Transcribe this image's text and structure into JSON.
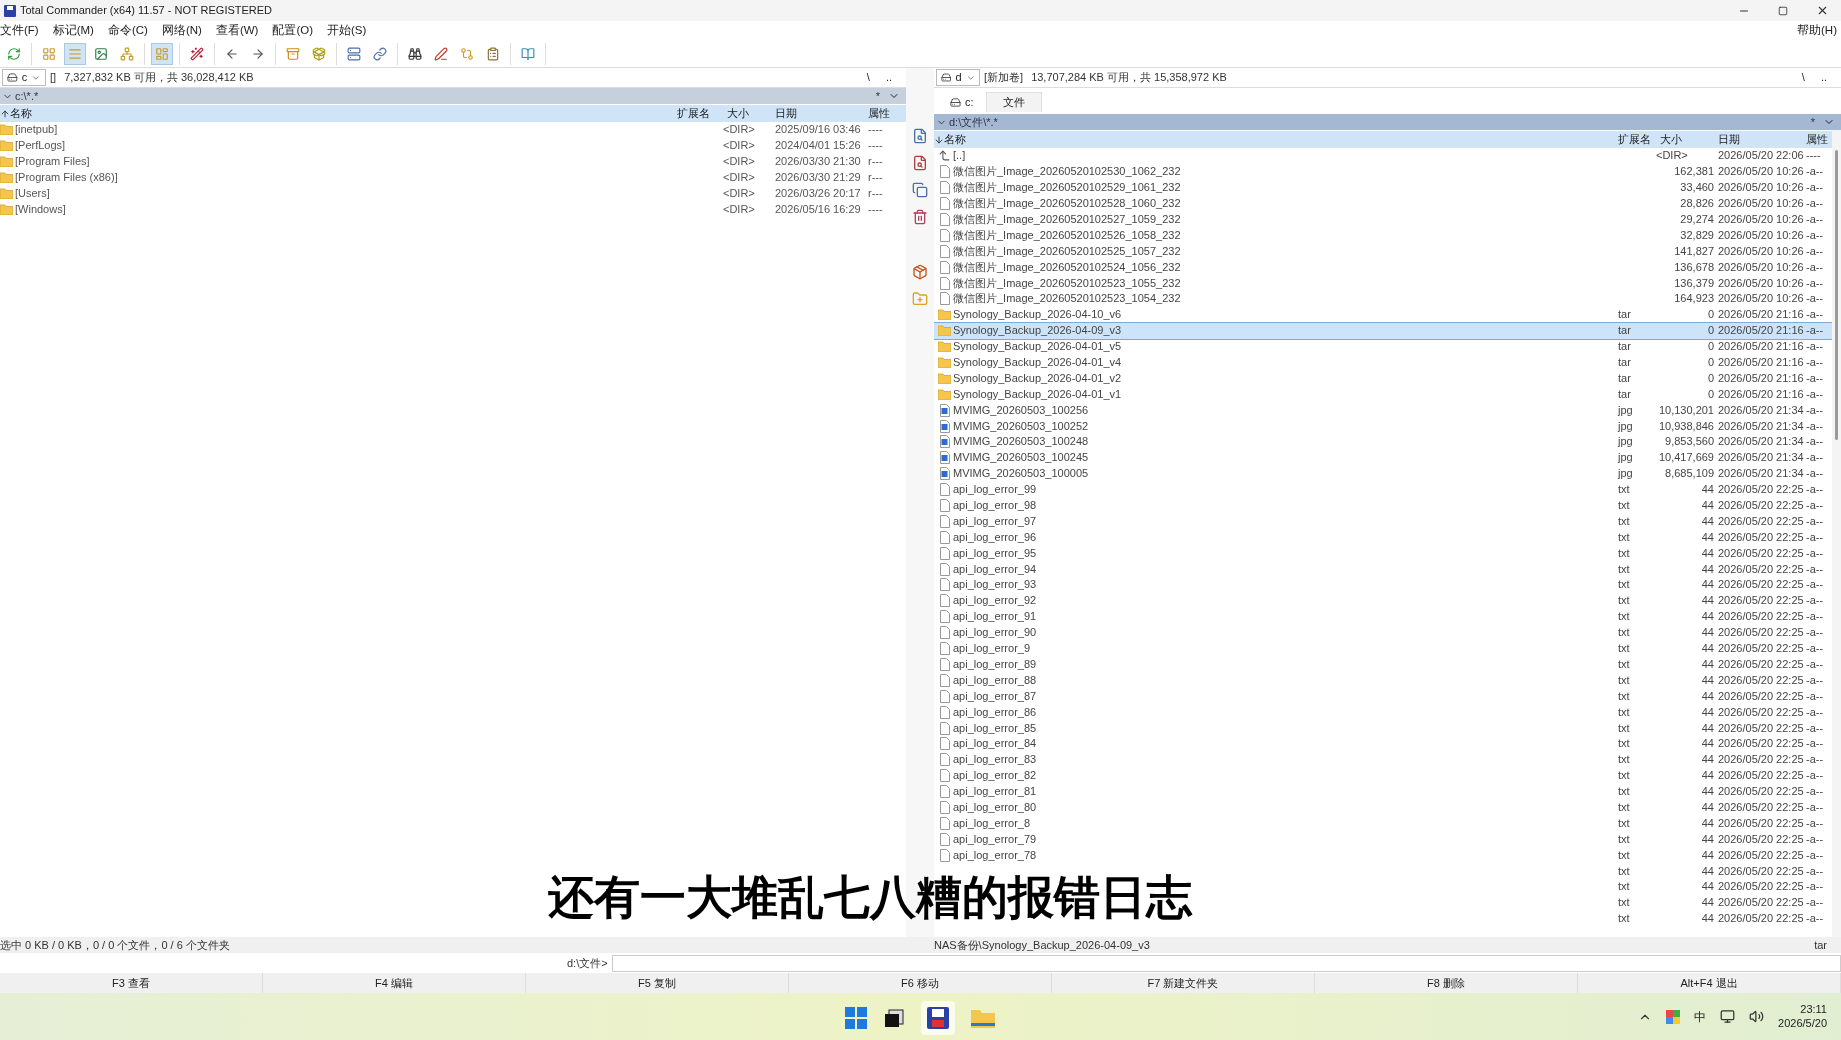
{
  "window": {
    "title": "Total Commander (x64) 11.57 - NOT REGISTERED",
    "help": "帮助(H)"
  },
  "menu": [
    "文件(F)",
    "标记(M)",
    "命令(C)",
    "网络(N)",
    "查看(W)",
    "配置(O)",
    "开始(S)"
  ],
  "toolbar": [
    [
      {
        "pressed": false
      }
    ],
    [
      {
        "pressed": false
      },
      {
        "pressed": true
      },
      {
        "pressed": false
      },
      {
        "pressed": false
      }
    ],
    [
      {
        "pressed": true
      }
    ],
    [
      {
        "pressed": false
      }
    ],
    [
      {
        "pressed": false
      },
      {
        "pressed": false
      }
    ],
    [
      {
        "pressed": false
      },
      {
        "pressed": false
      }
    ],
    [
      {
        "pressed": false
      },
      {
        "pressed": false
      }
    ],
    [
      {
        "pressed": false
      },
      {
        "pressed": false
      },
      {
        "pressed": false
      },
      {
        "pressed": false
      }
    ],
    [
      {
        "pressed": false
      }
    ]
  ],
  "left_panel": {
    "drive": "c",
    "volume": "[]",
    "free_space": "7,327,832 KB 可用，共 36,028,412 KB",
    "nav": [
      "\\",
      ".."
    ],
    "path": "c:\\*.*",
    "star": "*",
    "columns": [
      "名称",
      "扩展名",
      "大小",
      "日期",
      "属性"
    ],
    "rows": [
      {
        "kind": "folder",
        "name": "[inetpub]",
        "size": "<DIR>",
        "date": "2025/09/16 03:46",
        "attr": "----",
        "selected": false
      },
      {
        "kind": "folder",
        "name": "[PerfLogs]",
        "size": "<DIR>",
        "date": "2024/04/01 15:26",
        "attr": "----",
        "selected": false
      },
      {
        "kind": "folder",
        "name": "[Program Files]",
        "size": "<DIR>",
        "date": "2026/03/30 21:30",
        "attr": "r---",
        "selected": false
      },
      {
        "kind": "folder",
        "name": "[Program Files (x86)]",
        "size": "<DIR>",
        "date": "2026/03/30 21:29",
        "attr": "r---",
        "selected": false
      },
      {
        "kind": "folder",
        "name": "[Users]",
        "size": "<DIR>",
        "date": "2026/03/26 20:17",
        "attr": "r---",
        "selected": false
      },
      {
        "kind": "folder",
        "name": "[Windows]",
        "size": "<DIR>",
        "date": "2026/05/16 16:29",
        "attr": "----",
        "selected": false
      }
    ],
    "status": "选中 0 KB / 0 KB，0 / 0 个文件，0 / 6 个文件夹"
  },
  "right_panel": {
    "drive": "d",
    "volume": "[新加卷]",
    "free_space": "13,707,284 KB 可用，共 15,358,972 KB",
    "nav": [
      "\\",
      ".."
    ],
    "tabs": [
      {
        "label": "c:",
        "selected": false
      },
      {
        "label": "文件",
        "selected": true
      }
    ],
    "path": "d:\\文件\\*.*",
    "star": "*",
    "columns": [
      "名称",
      "扩展名",
      "大小",
      "日期",
      "属性"
    ],
    "rows": [
      {
        "kind": "up",
        "name": "[..]",
        "size": "<DIR>",
        "date": "2026/05/20 22:06",
        "attr": "----",
        "selected": false
      },
      {
        "kind": "file",
        "name": "微信图片_Image_20260520102530_1062_232",
        "size": "162,381",
        "date": "2026/05/20 10:26",
        "attr": "-a--",
        "selected": false
      },
      {
        "kind": "file",
        "name": "微信图片_Image_20260520102529_1061_232",
        "size": "33,460",
        "date": "2026/05/20 10:26",
        "attr": "-a--",
        "selected": false
      },
      {
        "kind": "file",
        "name": "微信图片_Image_20260520102528_1060_232",
        "size": "28,826",
        "date": "2026/05/20 10:26",
        "attr": "-a--",
        "selected": false
      },
      {
        "kind": "file",
        "name": "微信图片_Image_20260520102527_1059_232",
        "size": "29,274",
        "date": "2026/05/20 10:26",
        "attr": "-a--",
        "selected": false
      },
      {
        "kind": "file",
        "name": "微信图片_Image_20260520102526_1058_232",
        "size": "32,829",
        "date": "2026/05/20 10:26",
        "attr": "-a--",
        "selected": false
      },
      {
        "kind": "file",
        "name": "微信图片_Image_20260520102525_1057_232",
        "size": "141,827",
        "date": "2026/05/20 10:26",
        "attr": "-a--",
        "selected": false
      },
      {
        "kind": "file",
        "name": "微信图片_Image_20260520102524_1056_232",
        "size": "136,678",
        "date": "2026/05/20 10:26",
        "attr": "-a--",
        "selected": false
      },
      {
        "kind": "file",
        "name": "微信图片_Image_20260520102523_1055_232",
        "size": "136,379",
        "date": "2026/05/20 10:26",
        "attr": "-a--",
        "selected": false
      },
      {
        "kind": "file",
        "name": "微信图片_Image_20260520102523_1054_232",
        "size": "164,923",
        "date": "2026/05/20 10:26",
        "attr": "-a--",
        "selected": false
      },
      {
        "kind": "folder",
        "name": "Synology_Backup_2026-04-10_v6",
        "ext": "tar",
        "size": "0",
        "date": "2026/05/20 21:16",
        "attr": "-a--",
        "selected": false
      },
      {
        "kind": "folder",
        "name": "Synology_Backup_2026-04-09_v3",
        "ext": "tar",
        "size": "0",
        "date": "2026/05/20 21:16",
        "attr": "-a--",
        "selected": true
      },
      {
        "kind": "folder",
        "name": "Synology_Backup_2026-04-01_v5",
        "ext": "tar",
        "size": "0",
        "date": "2026/05/20 21:16",
        "attr": "-a--",
        "selected": false
      },
      {
        "kind": "folder",
        "name": "Synology_Backup_2026-04-01_v4",
        "ext": "tar",
        "size": "0",
        "date": "2026/05/20 21:16",
        "attr": "-a--",
        "selected": false
      },
      {
        "kind": "folder",
        "name": "Synology_Backup_2026-04-01_v2",
        "ext": "tar",
        "size": "0",
        "date": "2026/05/20 21:16",
        "attr": "-a--",
        "selected": false
      },
      {
        "kind": "folder",
        "name": "Synology_Backup_2026-04-01_v1",
        "ext": "tar",
        "size": "0",
        "date": "2026/05/20 21:16",
        "attr": "-a--",
        "selected": false
      },
      {
        "kind": "image",
        "name": "MVIMG_20260503_100256",
        "ext": "jpg",
        "size": "10,130,201",
        "date": "2026/05/20 21:34",
        "attr": "-a--",
        "selected": false
      },
      {
        "kind": "image",
        "name": "MVIMG_20260503_100252",
        "ext": "jpg",
        "size": "10,938,846",
        "date": "2026/05/20 21:34",
        "attr": "-a--",
        "selected": false
      },
      {
        "kind": "image",
        "name": "MVIMG_20260503_100248",
        "ext": "jpg",
        "size": "9,853,560",
        "date": "2026/05/20 21:34",
        "attr": "-a--",
        "selected": false
      },
      {
        "kind": "image",
        "name": "MVIMG_20260503_100245",
        "ext": "jpg",
        "size": "10,417,669",
        "date": "2026/05/20 21:34",
        "attr": "-a--",
        "selected": false
      },
      {
        "kind": "image",
        "name": "MVIMG_20260503_100005",
        "ext": "jpg",
        "size": "8,685,109",
        "date": "2026/05/20 21:34",
        "attr": "-a--",
        "selected": false
      },
      {
        "kind": "file",
        "name": "api_log_error_99",
        "ext": "txt",
        "size": "44",
        "date": "2026/05/20 22:25",
        "attr": "-a--",
        "selected": false
      },
      {
        "kind": "file",
        "name": "api_log_error_98",
        "ext": "txt",
        "size": "44",
        "date": "2026/05/20 22:25",
        "attr": "-a--",
        "selected": false
      },
      {
        "kind": "file",
        "name": "api_log_error_97",
        "ext": "txt",
        "size": "44",
        "date": "2026/05/20 22:25",
        "attr": "-a--",
        "selected": false
      },
      {
        "kind": "file",
        "name": "api_log_error_96",
        "ext": "txt",
        "size": "44",
        "date": "2026/05/20 22:25",
        "attr": "-a--",
        "selected": false
      },
      {
        "kind": "file",
        "name": "api_log_error_95",
        "ext": "txt",
        "size": "44",
        "date": "2026/05/20 22:25",
        "attr": "-a--",
        "selected": false
      },
      {
        "kind": "file",
        "name": "api_log_error_94",
        "ext": "txt",
        "size": "44",
        "date": "2026/05/20 22:25",
        "attr": "-a--",
        "selected": false
      },
      {
        "kind": "file",
        "name": "api_log_error_93",
        "ext": "txt",
        "size": "44",
        "date": "2026/05/20 22:25",
        "attr": "-a--",
        "selected": false
      },
      {
        "kind": "file",
        "name": "api_log_error_92",
        "ext": "txt",
        "size": "44",
        "date": "2026/05/20 22:25",
        "attr": "-a--",
        "selected": false
      },
      {
        "kind": "file",
        "name": "api_log_error_91",
        "ext": "txt",
        "size": "44",
        "date": "2026/05/20 22:25",
        "attr": "-a--",
        "selected": false
      },
      {
        "kind": "file",
        "name": "api_log_error_90",
        "ext": "txt",
        "size": "44",
        "date": "2026/05/20 22:25",
        "attr": "-a--",
        "selected": false
      },
      {
        "kind": "file",
        "name": "api_log_error_9",
        "ext": "txt",
        "size": "44",
        "date": "2026/05/20 22:25",
        "attr": "-a--",
        "selected": false
      },
      {
        "kind": "file",
        "name": "api_log_error_89",
        "ext": "txt",
        "size": "44",
        "date": "2026/05/20 22:25",
        "attr": "-a--",
        "selected": false
      },
      {
        "kind": "file",
        "name": "api_log_error_88",
        "ext": "txt",
        "size": "44",
        "date": "2026/05/20 22:25",
        "attr": "-a--",
        "selected": false
      },
      {
        "kind": "file",
        "name": "api_log_error_87",
        "ext": "txt",
        "size": "44",
        "date": "2026/05/20 22:25",
        "attr": "-a--",
        "selected": false
      },
      {
        "kind": "file",
        "name": "api_log_error_86",
        "ext": "txt",
        "size": "44",
        "date": "2026/05/20 22:25",
        "attr": "-a--",
        "selected": false
      },
      {
        "kind": "file",
        "name": "api_log_error_85",
        "ext": "txt",
        "size": "44",
        "date": "2026/05/20 22:25",
        "attr": "-a--",
        "selected": false
      },
      {
        "kind": "file",
        "name": "api_log_error_84",
        "ext": "txt",
        "size": "44",
        "date": "2026/05/20 22:25",
        "attr": "-a--",
        "selected": false
      },
      {
        "kind": "file",
        "name": "api_log_error_83",
        "ext": "txt",
        "size": "44",
        "date": "2026/05/20 22:25",
        "attr": "-a--",
        "selected": false
      },
      {
        "kind": "file",
        "name": "api_log_error_82",
        "ext": "txt",
        "size": "44",
        "date": "2026/05/20 22:25",
        "attr": "-a--",
        "selected": false
      },
      {
        "kind": "file",
        "name": "api_log_error_81",
        "ext": "txt",
        "size": "44",
        "date": "2026/05/20 22:25",
        "attr": "-a--",
        "selected": false
      },
      {
        "kind": "file",
        "name": "api_log_error_80",
        "ext": "txt",
        "size": "44",
        "date": "2026/05/20 22:25",
        "attr": "-a--",
        "selected": false
      },
      {
        "kind": "file",
        "name": "api_log_error_8",
        "ext": "txt",
        "size": "44",
        "date": "2026/05/20 22:25",
        "attr": "-a--",
        "selected": false
      },
      {
        "kind": "file",
        "name": "api_log_error_79",
        "ext": "txt",
        "size": "44",
        "date": "2026/05/20 22:25",
        "attr": "-a--",
        "selected": false
      },
      {
        "kind": "file",
        "name": "api_log_error_78",
        "ext": "txt",
        "size": "44",
        "date": "2026/05/20 22:25",
        "attr": "-a--",
        "selected": false
      },
      {
        "kind": "file",
        "ext": "txt",
        "size": "44",
        "date": "2026/05/20 22:25",
        "attr": "-a--",
        "selected": false
      },
      {
        "kind": "file",
        "ext": "txt",
        "size": "44",
        "date": "2026/05/20 22:25",
        "attr": "-a--",
        "selected": false
      },
      {
        "kind": "file",
        "ext": "txt",
        "size": "44",
        "date": "2026/05/20 22:25",
        "attr": "-a--",
        "selected": false
      },
      {
        "kind": "file",
        "ext": "txt",
        "size": "44",
        "date": "2026/05/20 22:25",
        "attr": "-a--",
        "selected": false
      }
    ],
    "status": "NAS备份\\Synology_Backup_2026-04-09_v3",
    "status_ext": "tar"
  },
  "command_line": {
    "prompt": "d:\\文件>"
  },
  "function_keys": [
    "F3 查看",
    "F4 编辑",
    "F5 复制",
    "F6 移动",
    "F7 新建文件夹",
    "F8 删除",
    "Alt+F4 退出"
  ],
  "subtitle": "还有一大堆乱七八糟的报错日志",
  "taskbar": {
    "ime": "中",
    "time": "23:11",
    "date": "2026/5/20"
  }
}
